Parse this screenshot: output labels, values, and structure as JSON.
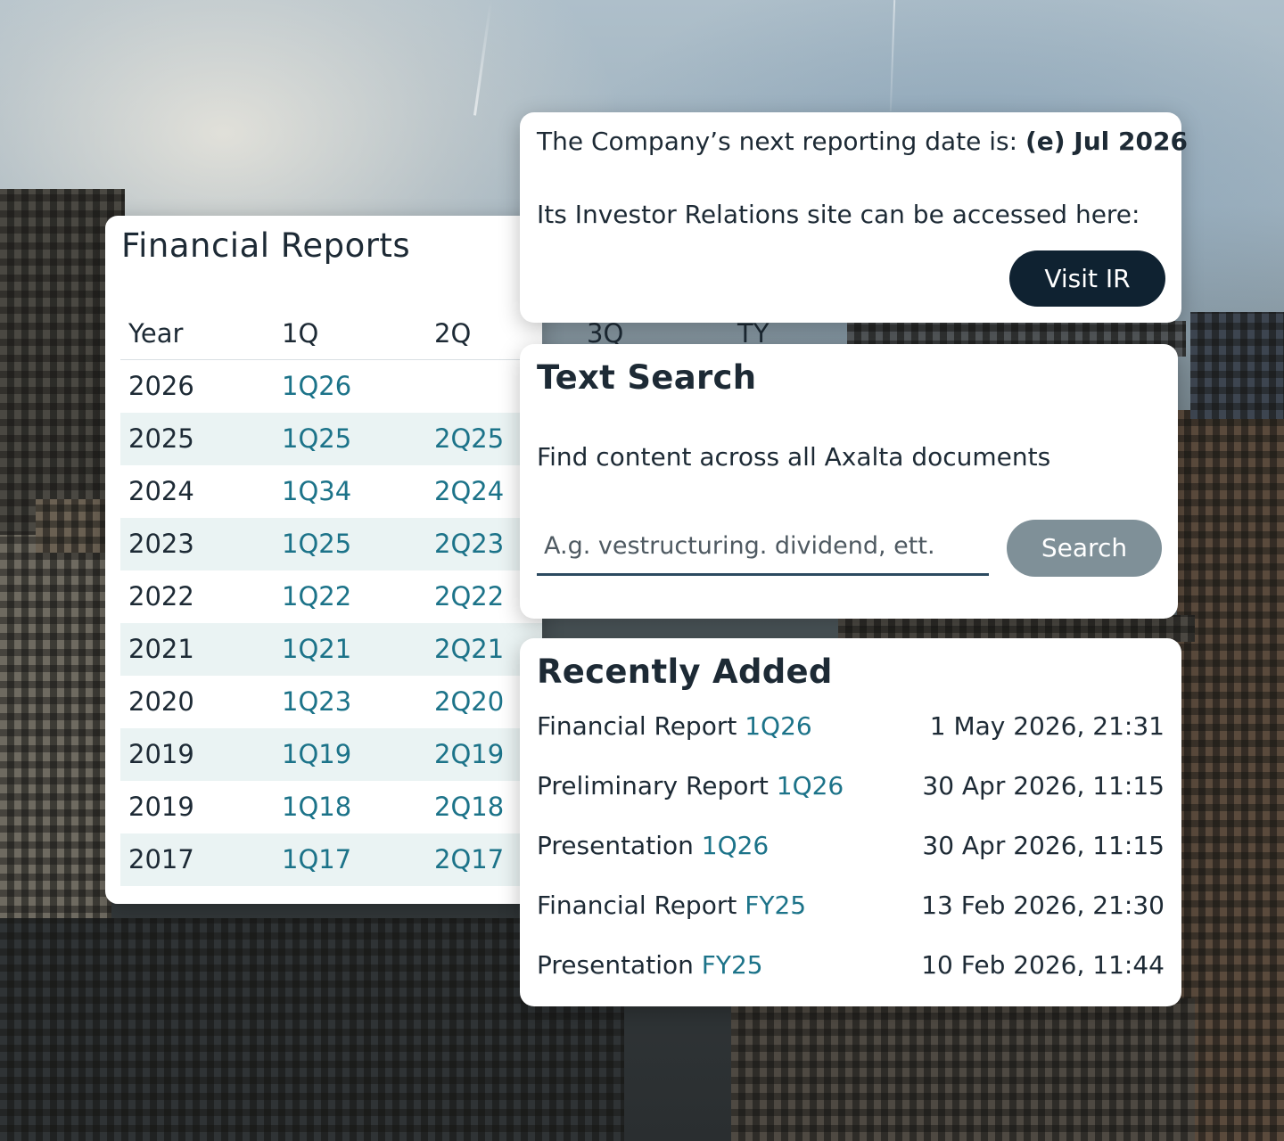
{
  "reports": {
    "title": "Financial Reports",
    "headers": [
      "Year",
      "1Q",
      "2Q",
      "3Q",
      "TY"
    ],
    "rows": [
      {
        "year": "2026",
        "q1": "1Q26",
        "q2": ""
      },
      {
        "year": "2025",
        "q1": "1Q25",
        "q2": "2Q25"
      },
      {
        "year": "2024",
        "q1": "1Q34",
        "q2": "2Q24"
      },
      {
        "year": "2023",
        "q1": "1Q25",
        "q2": "2Q23"
      },
      {
        "year": "2022",
        "q1": "1Q22",
        "q2": "2Q22"
      },
      {
        "year": "2021",
        "q1": "1Q21",
        "q2": "2Q21"
      },
      {
        "year": "2020",
        "q1": "1Q23",
        "q2": "2Q20"
      },
      {
        "year": "2019",
        "q1": "1Q19",
        "q2": "2Q19"
      },
      {
        "year": "2019",
        "q1": "1Q18",
        "q2": "2Q18"
      },
      {
        "year": "2017",
        "q1": "1Q17",
        "q2": "2Q17"
      }
    ]
  },
  "ir": {
    "line1_prefix": "The Company’s next reporting date is: ",
    "line1_date": "(e) Jul 2026",
    "line2": "Its Investor Relations site can be accessed here:",
    "button": "Visit IR"
  },
  "search": {
    "title": "Text Search",
    "description": "Find content across all Axalta documents",
    "placeholder": "A.g. vestructuring. dividend, ett.",
    "value": "",
    "button": "Search"
  },
  "recent": {
    "title": "Recently Added",
    "items": [
      {
        "label": "Financial Report",
        "link": "1Q26",
        "date": "1 May 2026, 21:31"
      },
      {
        "label": "Preliminary Report",
        "link": "1Q26",
        "date": "30 Apr 2026, 11:15"
      },
      {
        "label": "Presentation",
        "link": "1Q26",
        "date": "30 Apr 2026, 11:15"
      },
      {
        "label": "Financial Report",
        "link": "FY25",
        "date": "13 Feb 2026, 21:30"
      },
      {
        "label": "Presentation",
        "link": "FY25",
        "date": "10 Feb 2026, 11:44"
      }
    ]
  },
  "colors": {
    "link": "#1c7389",
    "text": "#1d2a35",
    "primary_button": "#0f2231",
    "search_button": "#7f9098",
    "row_alt": "#eaf3f3"
  }
}
